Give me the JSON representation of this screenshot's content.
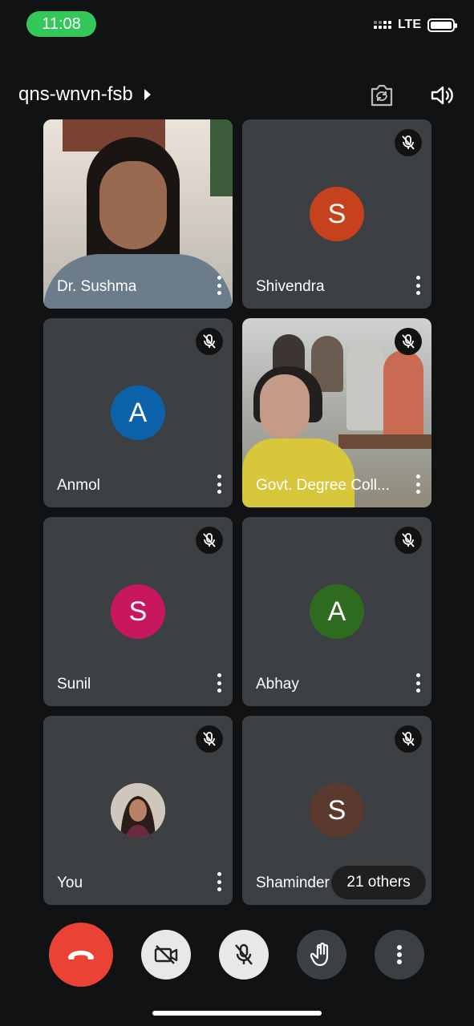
{
  "status_bar": {
    "time": "11:08",
    "network": "LTE",
    "time_pill_color": "#34c759"
  },
  "header": {
    "meeting_code": "qns-wnvn-fsb",
    "icons": [
      "switch-camera-icon",
      "speaker-icon"
    ]
  },
  "participants": [
    {
      "name": "Dr. Sushma",
      "type": "video",
      "muted": false
    },
    {
      "name": "Shivendra",
      "type": "avatar",
      "initial": "S",
      "color": "#c5421d",
      "muted": true
    },
    {
      "name": "Anmol",
      "type": "avatar",
      "initial": "A",
      "color": "#0b62a8",
      "muted": true
    },
    {
      "name": "Govt. Degree Coll...",
      "type": "video",
      "muted": true
    },
    {
      "name": "Sunil",
      "type": "avatar",
      "initial": "S",
      "color": "#c7175f",
      "muted": true
    },
    {
      "name": "Abhay",
      "type": "avatar",
      "initial": "A",
      "color": "#2e6b1f",
      "muted": true
    },
    {
      "name": "You",
      "type": "photo",
      "muted": true
    },
    {
      "name": "Shaminder",
      "type": "avatar",
      "initial": "S",
      "color": "#5a3a2e",
      "muted": true
    }
  ],
  "others_pill": "21 others",
  "controls": [
    {
      "name": "end-call",
      "color": "#ea4335"
    },
    {
      "name": "camera-off",
      "color": "#e8e8e8"
    },
    {
      "name": "mic-off",
      "color": "#e8e8e8"
    },
    {
      "name": "raise-hand",
      "color": "#3c4043"
    },
    {
      "name": "more-options",
      "color": "#3c4043"
    }
  ]
}
